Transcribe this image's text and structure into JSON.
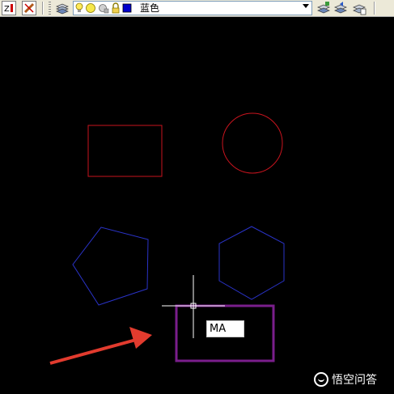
{
  "toolbar": {
    "layer_name": "蓝色",
    "layer_color": "#0000cc",
    "icons": [
      "layer-properties-icon",
      "light-bulb-icon",
      "sun-freeze-icon",
      "lock-icon",
      "color-swatch-icon"
    ]
  },
  "drawing": {
    "command_input": "MA",
    "colors": {
      "red_shapes": "#c8141e",
      "blue_shapes": "#2a33c8",
      "highlight_box": "#7a1e8c",
      "arrow": "#e23b2e",
      "crosshair": "#ffffff"
    }
  },
  "watermark": {
    "text": "悟空问答"
  }
}
